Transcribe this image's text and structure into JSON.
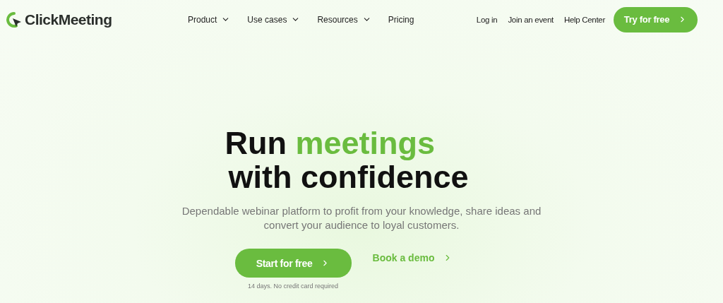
{
  "brand": {
    "name": "ClickMeeting"
  },
  "nav": [
    {
      "label": "Product",
      "dropdown": true
    },
    {
      "label": "Use cases",
      "dropdown": true
    },
    {
      "label": "Resources",
      "dropdown": true
    },
    {
      "label": "Pricing",
      "dropdown": false
    }
  ],
  "links": [
    "Log in",
    "Join an event",
    "Help Center"
  ],
  "cta": {
    "label": "Try for free"
  },
  "hero": {
    "heading": [
      [
        {
          "text": "Run ",
          "accent": false
        },
        {
          "text": "meetings",
          "accent": true
        }
      ],
      [
        {
          "text": "with confidence",
          "accent": false
        }
      ]
    ],
    "subtitle": "Dependable webinar platform to profit from your knowledge, share ideas and convert your audience to loyal customers.",
    "primary": {
      "label": "Start for free"
    },
    "secondary": {
      "label": "Book a demo"
    },
    "note": "14 days. No credit card required"
  }
}
